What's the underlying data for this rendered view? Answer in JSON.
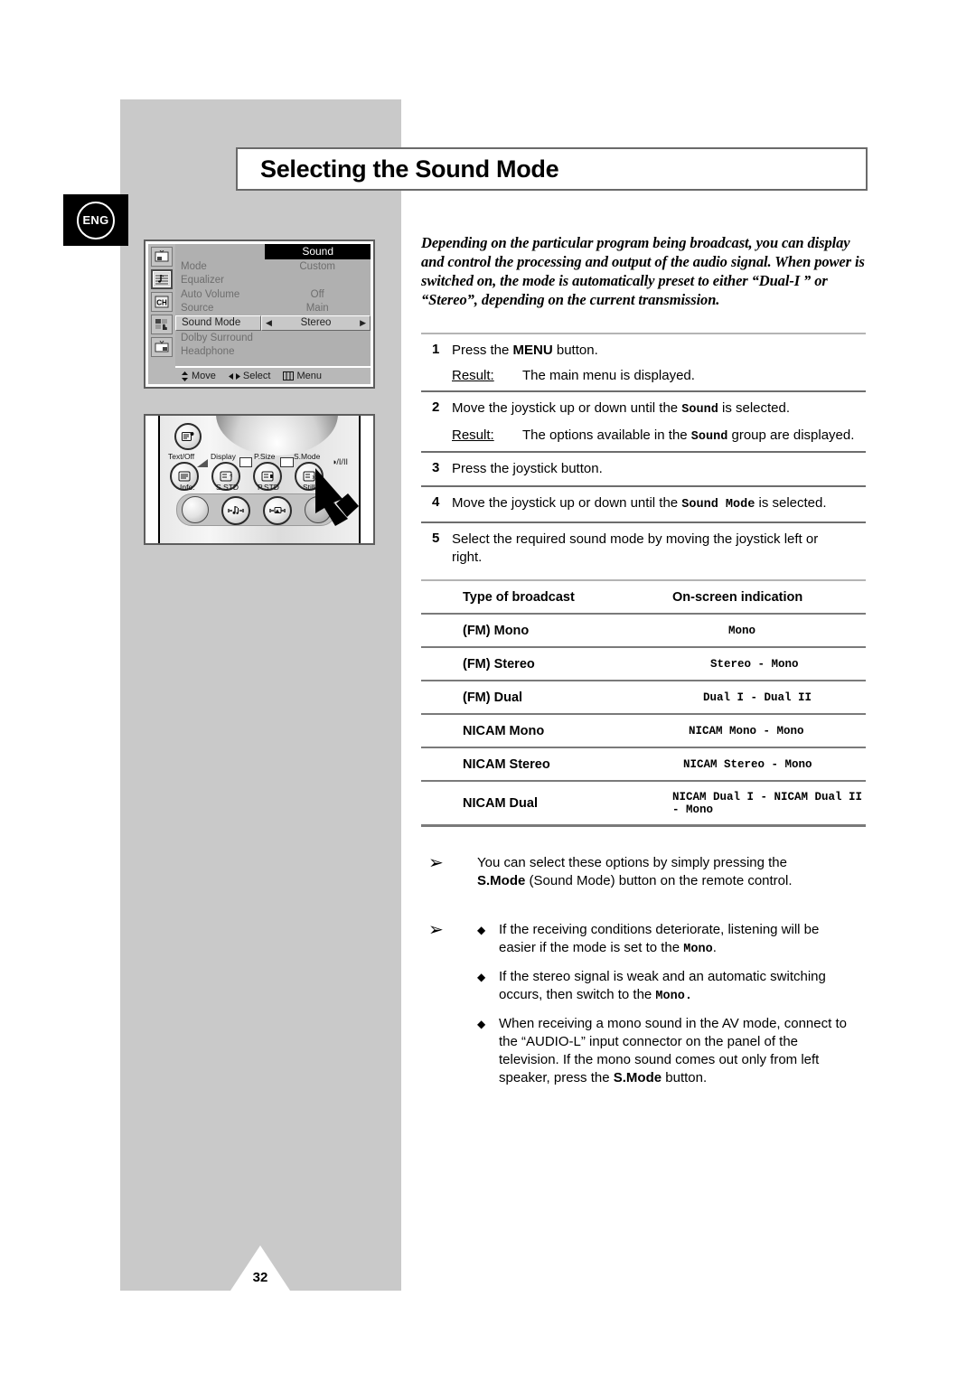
{
  "page": {
    "language_badge": "ENG",
    "title": "Selecting the Sound Mode",
    "page_number": "32",
    "colors": {
      "sidebar_gray": "#c9c9c9",
      "rule_gray": "#7a7a7a",
      "osd_bg": "#b0b0b0",
      "osd_highlight_bar": "#000000"
    }
  },
  "osd": {
    "title": "Sound",
    "icons": [
      {
        "name": "picture-icon"
      },
      {
        "name": "sound-icon",
        "selected": true
      },
      {
        "name": "channel-icon"
      },
      {
        "name": "setup-icon"
      },
      {
        "name": "installation-icon"
      }
    ],
    "rows": [
      {
        "label": "Mode",
        "value": "Custom"
      },
      {
        "label": "Equalizer",
        "value": ""
      },
      {
        "label": "Auto Volume",
        "value": "Off"
      },
      {
        "label": "Source",
        "value": "Main"
      },
      {
        "label": "Sound Mode",
        "value": "Stereo",
        "highlighted": true
      },
      {
        "label": "Dolby Surround",
        "value": ""
      },
      {
        "label": "Headphone",
        "value": ""
      }
    ],
    "footer": [
      {
        "icon": "up-down-arrow",
        "label": "Move"
      },
      {
        "icon": "left-right-arrow",
        "label": "Select"
      },
      {
        "icon": "menu-grid",
        "label": "Menu"
      }
    ],
    "selector_left_arrow": "◀",
    "selector_right_arrow": "▶"
  },
  "remote": {
    "top_labels": [
      "Text/Off",
      "Display",
      "P.Size",
      "S.Mode"
    ],
    "bottom_labels": [
      "Info.",
      "S.STD",
      "P.STD",
      "Still"
    ],
    "side_symbol": "◑/I/II"
  },
  "intro": "Depending on the particular program being broadcast, you can display and control the processing and output of the audio signal. When power is switched on, the mode is automatically preset to either “Dual-I ” or “Stereo”, depending on the current transmission.",
  "steps": [
    {
      "num": "1",
      "text_before": "Press the ",
      "text_bold": "MENU",
      "text_after": " button.",
      "result_label": "Result:",
      "result_before": "The main menu is displayed.",
      "result_mono": "",
      "result_after": ""
    },
    {
      "num": "2",
      "text_before": "Move the joystick up or down until the ",
      "text_mono": "Sound",
      "text_after": " is selected.",
      "result_label": "Result:",
      "result_before": "The options available in the ",
      "result_mono": "Sound",
      "result_after": " group are displayed."
    },
    {
      "num": "3",
      "text_before": "Press the joystick button.",
      "text_mono": "",
      "text_after": ""
    },
    {
      "num": "4",
      "text_before": "Move the joystick up or down until the ",
      "text_mono": "Sound Mode",
      "text_after": " is selected."
    },
    {
      "num": "5",
      "text_before": "Select the required sound mode by moving the joystick left or right.",
      "text_mono": "",
      "text_after": ""
    }
  ],
  "table": {
    "headers": [
      "Type of broadcast",
      "On-screen indication"
    ],
    "rows": [
      {
        "type": "(FM) Mono",
        "indication": "Mono"
      },
      {
        "type": "(FM) Stereo",
        "indication": "Stereo - Mono"
      },
      {
        "type": "(FM) Dual",
        "indication": "Dual I - Dual II"
      },
      {
        "type": "NICAM Mono",
        "indication": "NICAM Mono - Mono"
      },
      {
        "type": "NICAM Stereo",
        "indication": "NICAM Stereo - Mono"
      },
      {
        "type": "NICAM Dual",
        "indication": "NICAM Dual I - NICAM Dual II - Mono"
      }
    ]
  },
  "notes": {
    "arrow_glyph": "➢",
    "bullet_glyph": "◆",
    "note1": {
      "before": "You can select these options by simply pressing the ",
      "bold": "S.Mode",
      "after": " (Sound Mode) button on the remote control."
    },
    "note2_items": [
      {
        "before": "If the receiving conditions deteriorate, listening will be easier  if the mode is set to the ",
        "mono": "Mono",
        "after": "."
      },
      {
        "before": "If the stereo signal is weak and an automatic switching occurs, then switch to the ",
        "mono": "Mono.",
        "after": ""
      },
      {
        "before": "When receiving a mono sound in the AV mode, connect to the “AUDIO-L” input connector on the panel of the television. If the mono sound comes out only from left speaker, press the ",
        "bold": "S.Mode",
        "after": " button."
      }
    ]
  }
}
